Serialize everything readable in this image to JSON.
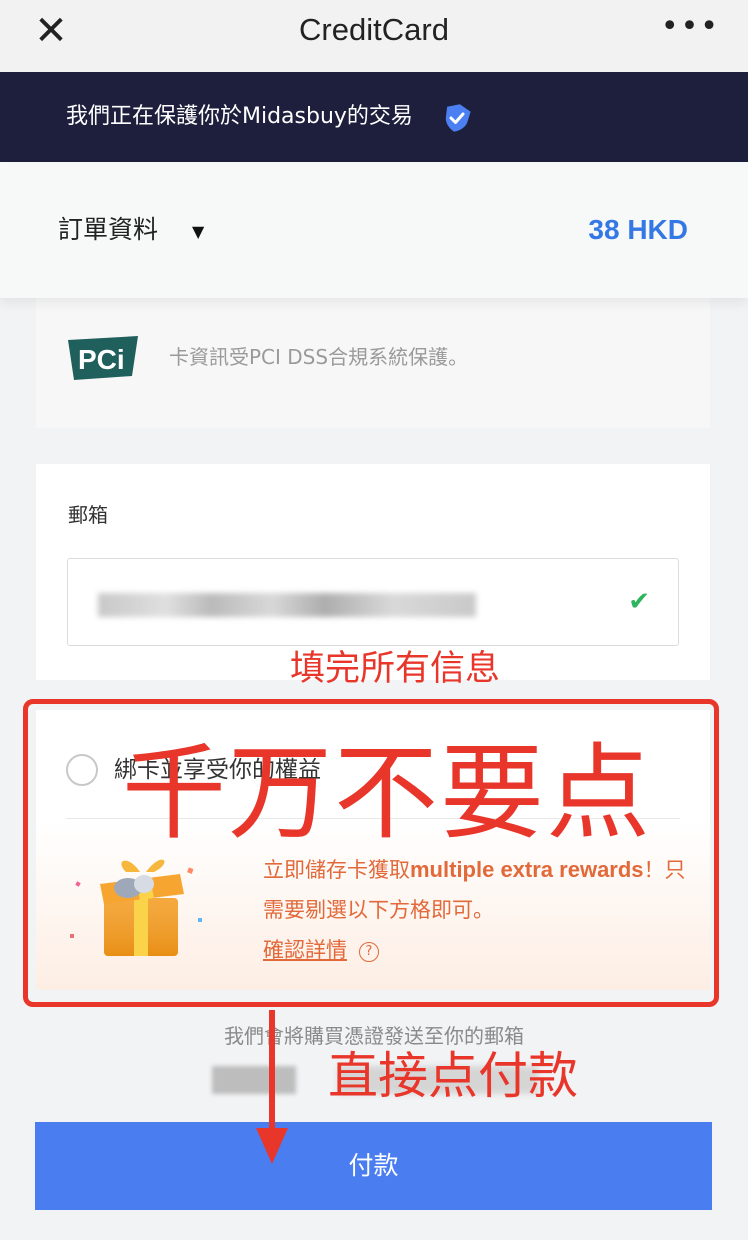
{
  "topbar": {
    "close_icon": "✕",
    "title": "CreditCard",
    "more_icon": "•••"
  },
  "secure": {
    "text": "我們正在保護你於Midasbuy的交易",
    "icon": "shield-check-icon"
  },
  "order": {
    "label": "訂單資料",
    "caret": "▼",
    "amount": "38 HKD"
  },
  "pci": {
    "logo_text": "PCi",
    "text": "卡資訊受PCI DSS合規系統保護。"
  },
  "email": {
    "label": "郵箱",
    "value_hidden": true,
    "check_icon": "✔"
  },
  "rewards": {
    "radio_label": "綁卡並享受你的權益",
    "promo_part1": "立即儲存卡獲取",
    "promo_en": "multiple extra rewards",
    "promo_part2": "！只需要剔選以下方格即可。",
    "details_link": "確認詳情",
    "help_icon": "?"
  },
  "receipt": {
    "text": "我們會將購買憑證發送至你的郵箱"
  },
  "pay_button": {
    "label": "付款"
  },
  "annotations": {
    "fill_all": "填完所有信息",
    "do_not_click": "千万不要点",
    "click_pay": "直接点付款"
  },
  "colors": {
    "accent_blue": "#3478e6",
    "pay_blue": "#4a7ef0",
    "annotation_red": "#e8362b",
    "promo_orange": "#e2693a",
    "secure_bg": "#1d1f3d"
  }
}
